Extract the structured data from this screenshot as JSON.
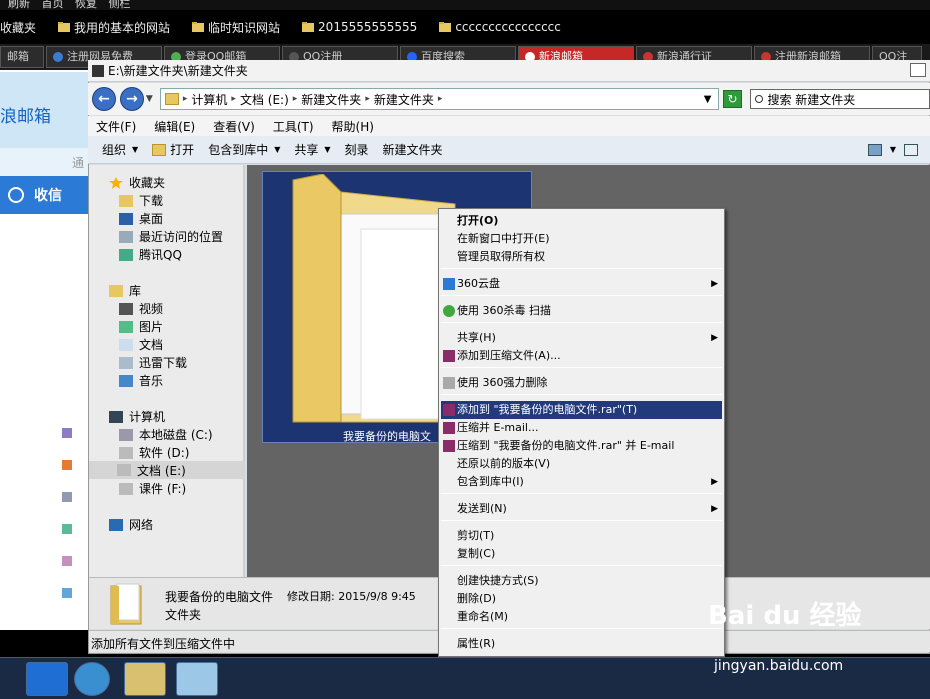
{
  "browser_menu": [
    "刷新",
    "首页",
    "恢复",
    "侧栏"
  ],
  "bookmarks": [
    {
      "label": "收藏夹"
    },
    {
      "label": "我用的基本的网站"
    },
    {
      "label": "临时知识网站"
    },
    {
      "label": "2015555555555"
    },
    {
      "label": "cccccccccccccccc"
    }
  ],
  "browser_tabs": [
    {
      "label": "邮箱"
    },
    {
      "label": "注册网易免费"
    },
    {
      "label": "登录QQ邮箱"
    },
    {
      "label": "QQ注册"
    },
    {
      "label": "百度搜索"
    },
    {
      "label": "新浪邮箱",
      "active": true
    },
    {
      "label": "新浪通行证"
    },
    {
      "label": "注册新浪邮箱"
    },
    {
      "label": "QQ注"
    }
  ],
  "webpage": {
    "brand": "浪邮箱",
    "nav_hint": "通",
    "inbox_label": "收信",
    "marker_colors": [
      "#8e7cc3",
      "#e07b39",
      "#8f9ab0",
      "#5fb89a",
      "#c58fc0",
      "#62a6d8"
    ]
  },
  "explorer": {
    "title": "E:\\新建文件夹\\新建文件夹",
    "breadcrumb": [
      "计算机",
      "文档 (E:)",
      "新建文件夹",
      "新建文件夹"
    ],
    "search_placeholder": "搜索 新建文件夹",
    "menus": [
      "文件(F)",
      "编辑(E)",
      "查看(V)",
      "工具(T)",
      "帮助(H)"
    ],
    "toolbar": {
      "organize": "组织",
      "open": "打开",
      "include_library": "包含到库中",
      "share": "共享",
      "burn": "刻录",
      "new_folder": "新建文件夹"
    },
    "nav": {
      "favorites": "收藏夹",
      "downloads": "下载",
      "desktop": "桌面",
      "recent": "最近访问的位置",
      "tencent": "腾讯QQ",
      "libraries": "库",
      "videos": "视频",
      "pictures": "图片",
      "documents": "文档",
      "thunder": "迅雷下载",
      "music": "音乐",
      "computer": "计算机",
      "drive_c": "本地磁盘 (C:)",
      "drive_d": "软件 (D:)",
      "drive_e": "文档 (E:)",
      "drive_f": "课件 (F:)",
      "network": "网络"
    },
    "folder_name": "我要备份的电脑文",
    "details": {
      "name": "我要备份的电脑文件",
      "modified": "修改日期: 2015/9/8 9:45",
      "type": "文件夹"
    },
    "status": "添加所有文件到压缩文件中"
  },
  "context_menu": {
    "open": "打开(O)",
    "open_new_window": "在新窗口中打开(E)",
    "take_ownership": "管理员取得所有权",
    "cloud360": "360云盘",
    "scan360": "使用 360杀毒 扫描",
    "share": "共享(H)",
    "add_archive": "添加到压缩文件(A)...",
    "force_delete": "使用 360强力删除",
    "add_to_rar": "添加到 \"我要备份的电脑文件.rar\"(T)",
    "compress_email": "压缩并 E-mail...",
    "compress_rar_email": "压缩到 \"我要备份的电脑文件.rar\" 并 E-mail",
    "restore_versions": "还原以前的版本(V)",
    "include_library": "包含到库中(I)",
    "send_to": "发送到(N)",
    "cut": "剪切(T)",
    "copy": "复制(C)",
    "create_shortcut": "创建快捷方式(S)",
    "delete": "删除(D)",
    "rename": "重命名(M)",
    "properties": "属性(R)"
  },
  "watermark": {
    "brand": "Bai du 经验",
    "url": "jingyan.baidu.com"
  },
  "icons": [
    "folder-icon",
    "back-icon",
    "forward-icon",
    "refresh-icon",
    "search-icon",
    "star-icon",
    "computer-icon",
    "network-icon",
    "drive-icon",
    "winrar-icon",
    "shield-icon",
    "cloud-icon",
    "submenu-arrow-icon"
  ]
}
